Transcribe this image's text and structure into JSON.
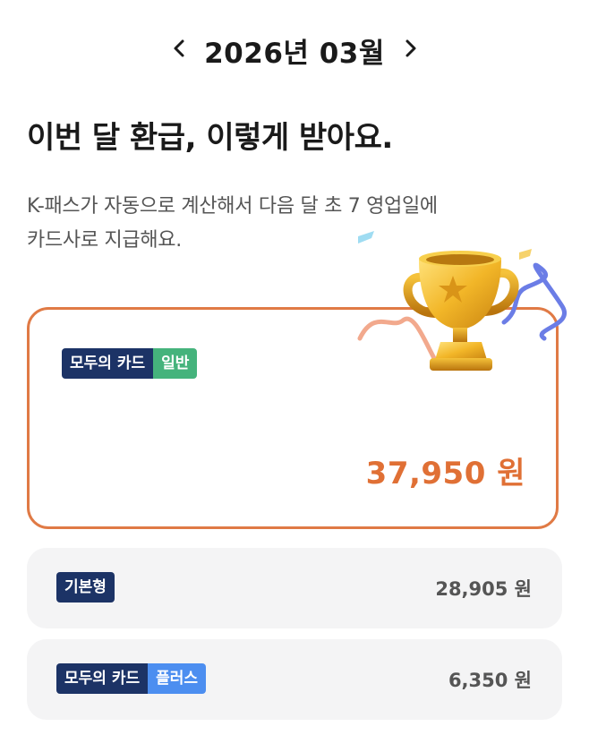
{
  "month_nav": {
    "title": "2026년 03월",
    "prev_icon": "chevron-left-icon",
    "next_icon": "chevron-right-icon"
  },
  "headline": "이번 달 환급, 이렇게 받아요.",
  "description": {
    "line1": "K-패스가 자동으로 계산해서 다음 달 초 7 영업일에",
    "line2": "카드사로 지급해요."
  },
  "main_card": {
    "badge_left": "모두의 카드",
    "badge_right": "일반",
    "amount": "37,950 원"
  },
  "rows": [
    {
      "badge": "기본형",
      "amount": "28,905 원"
    },
    {
      "badge_left": "모두의 카드",
      "badge_right": "플러스",
      "amount": "6,350 원"
    }
  ],
  "decoration": {
    "icon": "trophy-icon"
  },
  "colors": {
    "accent": "#e07035",
    "card_border": "#e07a45",
    "badge_navy": "#1c3366",
    "badge_green": "#45b37c",
    "badge_blue": "#4c8ef0",
    "row_bg": "#f4f4f5"
  }
}
